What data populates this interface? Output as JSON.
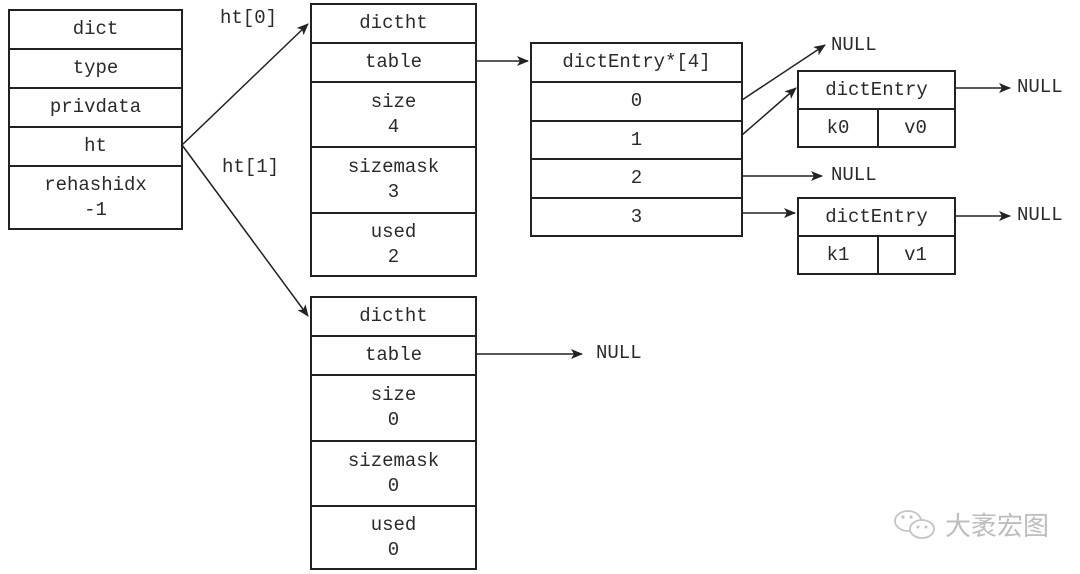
{
  "dict": {
    "fields": [
      {
        "name": "dict",
        "value": ""
      },
      {
        "name": "type",
        "value": ""
      },
      {
        "name": "privdata",
        "value": ""
      },
      {
        "name": "ht",
        "value": ""
      },
      {
        "name": "rehashidx",
        "value": "-1"
      }
    ]
  },
  "edge_labels": {
    "ht0": "ht[0]",
    "ht1": "ht[1]"
  },
  "ht0": {
    "title": "dictht",
    "table": "table",
    "size": {
      "name": "size",
      "value": "4"
    },
    "sizemask": {
      "name": "sizemask",
      "value": "3"
    },
    "used": {
      "name": "used",
      "value": "2"
    }
  },
  "ht1": {
    "title": "dictht",
    "table": "table",
    "size": {
      "name": "size",
      "value": "0"
    },
    "sizemask": {
      "name": "sizemask",
      "value": "0"
    },
    "used": {
      "name": "used",
      "value": "0"
    },
    "table_target": "NULL"
  },
  "bucket_array": {
    "title": "dictEntry*[4]",
    "indices": [
      "0",
      "1",
      "2",
      "3"
    ]
  },
  "entries": [
    {
      "title": "dictEntry",
      "key": "k0",
      "value": "v0",
      "next": "NULL"
    },
    {
      "title": "dictEntry",
      "key": "k1",
      "value": "v1",
      "next": "NULL"
    }
  ],
  "null_labels": {
    "bucket0": "NULL",
    "bucket2": "NULL"
  },
  "watermark": {
    "icon": "wechat-icon",
    "text": "大袤宏图"
  }
}
